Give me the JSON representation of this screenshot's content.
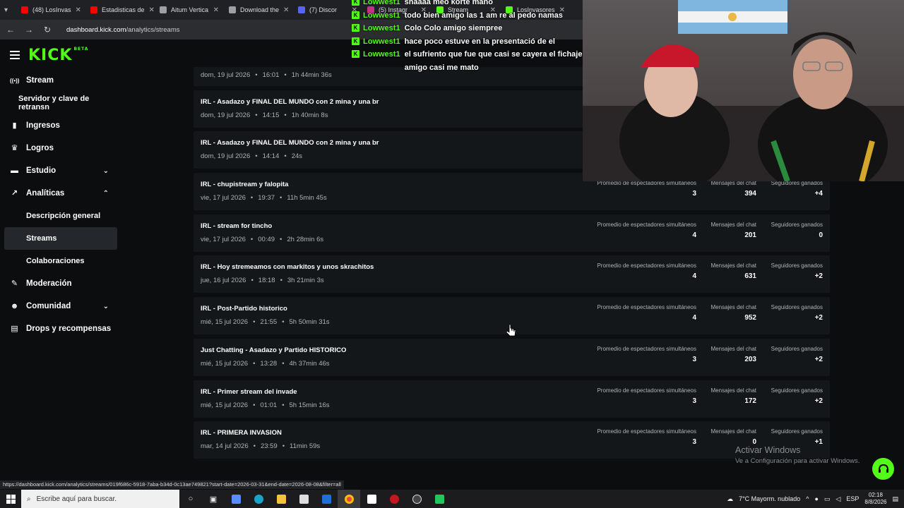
{
  "browser": {
    "tabs": [
      {
        "label": "(48) LosInvas",
        "color": "#ff0000"
      },
      {
        "label": "Estadisticas de",
        "color": "#ff0000"
      },
      {
        "label": "Aitum Vertica",
        "color": "#9aa0a6"
      },
      {
        "label": "Download the",
        "color": "#9aa0a6"
      },
      {
        "label": "(7) Discor",
        "color": "#5865f2"
      },
      {
        "label": "(5) Instagr",
        "color": "#c13584"
      },
      {
        "label": "Stream",
        "color": "#53fc18"
      },
      {
        "label": "LosInvasores",
        "color": "#53fc18"
      }
    ],
    "url_domain": "dashboard.kick.com",
    "url_path": "/analytics/streams"
  },
  "app": {
    "logo": "KICK",
    "logo_badge": "BETA"
  },
  "sidebar": {
    "items": [
      {
        "label": "Stream",
        "icon": "broadcast-icon"
      },
      {
        "label": "Servidor y clave de retransn",
        "sub": true,
        "plain": true
      },
      {
        "label": "Ingresos",
        "icon": "chart-icon"
      },
      {
        "label": "Logros",
        "icon": "trophy-icon"
      },
      {
        "label": "Estudio",
        "icon": "studio-icon",
        "chevron": "down"
      },
      {
        "label": "Analíticas",
        "icon": "analytics-icon",
        "chevron": "up"
      },
      {
        "label": "Descripción general",
        "sub": true
      },
      {
        "label": "Streams",
        "sub": true,
        "active": true
      },
      {
        "label": "Colaboraciones",
        "sub": true
      },
      {
        "label": "Moderación",
        "icon": "wrench-icon"
      },
      {
        "label": "Comunidad",
        "icon": "community-icon",
        "chevron": "down"
      },
      {
        "label": "Drops y recompensas",
        "icon": "drops-icon"
      }
    ]
  },
  "stat_labels": {
    "viewers": "Promedio de espectadores simultáneos",
    "chat": "Mensajes del chat",
    "followers": "Seguidores ganados"
  },
  "streams": [
    {
      "title": "",
      "date": "dom, 19 jul 2026",
      "time": "16:01",
      "duration": "1h 44min 36s"
    },
    {
      "title": "IRL - Asadazo y FINAL DEL MUNDO con 2 mina y una br",
      "date": "dom, 19 jul 2026",
      "time": "14:15",
      "duration": "1h 40min 8s"
    },
    {
      "title": "IRL - Asadazo y FINAL DEL MUNDO con 2 mina y una br",
      "date": "dom, 19 jul 2026",
      "time": "14:14",
      "duration": "24s"
    },
    {
      "title": "IRL - chupistream y falopita",
      "date": "vie, 17 jul 2026",
      "time": "19:37",
      "duration": "11h 5min 45s",
      "viewers": "3",
      "chat": "394",
      "followers": "+4"
    },
    {
      "title": "IRL - stream for tincho",
      "date": "vie, 17 jul 2026",
      "time": "00:49",
      "duration": "2h 28min 6s",
      "viewers": "4",
      "chat": "201",
      "followers": "0"
    },
    {
      "title": "IRL - Hoy stremeamos con markitos y unos skrachitos",
      "date": "jue, 16 jul 2026",
      "time": "18:18",
      "duration": "3h 21min 3s",
      "viewers": "4",
      "chat": "631",
      "followers": "+2"
    },
    {
      "title": "IRL - Post-Partido historico",
      "date": "mié, 15 jul 2026",
      "time": "21:55",
      "duration": "5h 50min 31s",
      "viewers": "4",
      "chat": "952",
      "followers": "+2"
    },
    {
      "title": "Just Chatting - Asadazo y Partido HISTORICO",
      "date": "mié, 15 jul 2026",
      "time": "13:28",
      "duration": "4h 37min 46s",
      "viewers": "3",
      "chat": "203",
      "followers": "+2"
    },
    {
      "title": "IRL - Primer stream del invade",
      "date": "mié, 15 jul 2026",
      "time": "01:01",
      "duration": "5h 15min 16s",
      "viewers": "3",
      "chat": "172",
      "followers": "+2"
    },
    {
      "title": "IRL - PRIMERA INVASION",
      "date": "mar, 14 jul 2026",
      "time": "23:59",
      "duration": "11min 59s",
      "viewers": "3",
      "chat": "0",
      "followers": "+1"
    }
  ],
  "chat": [
    {
      "user": "Lowwest1",
      "msg": "shaaaa meo korte mano"
    },
    {
      "user": "Lowwest1",
      "msg": "todo bien amigo las 1 am re al pedo namas"
    },
    {
      "user": "Lowwest1",
      "msg": "Colo Colo amigo siempree"
    },
    {
      "user": "Lowwest1",
      "msg": "hace poco estuve en la presentació de el"
    },
    {
      "user": "Lowwest1",
      "msg": "el sufriento que fue que casi se cayera el fichaje amigo casi me mato"
    }
  ],
  "watermark": {
    "title": "Activar Windows",
    "subtitle": "Ve a Configuración para activar Windows."
  },
  "status_url": "https://dashboard.kick.com/analytics/streams/019f686c-5918-7aba-b34d-0c13ae749821?start-date=2026-03-31&end-date=2026-08-08&filter=all",
  "taskbar": {
    "search_placeholder": "Escribe aquí para buscar.",
    "weather": "7°C  Mayorm. nublado",
    "lang": "ESP",
    "time": "02:18",
    "date": "8/8/2026"
  },
  "colors": {
    "accent": "#53fc18",
    "background": "#0b0d0f",
    "row": "#141719"
  }
}
